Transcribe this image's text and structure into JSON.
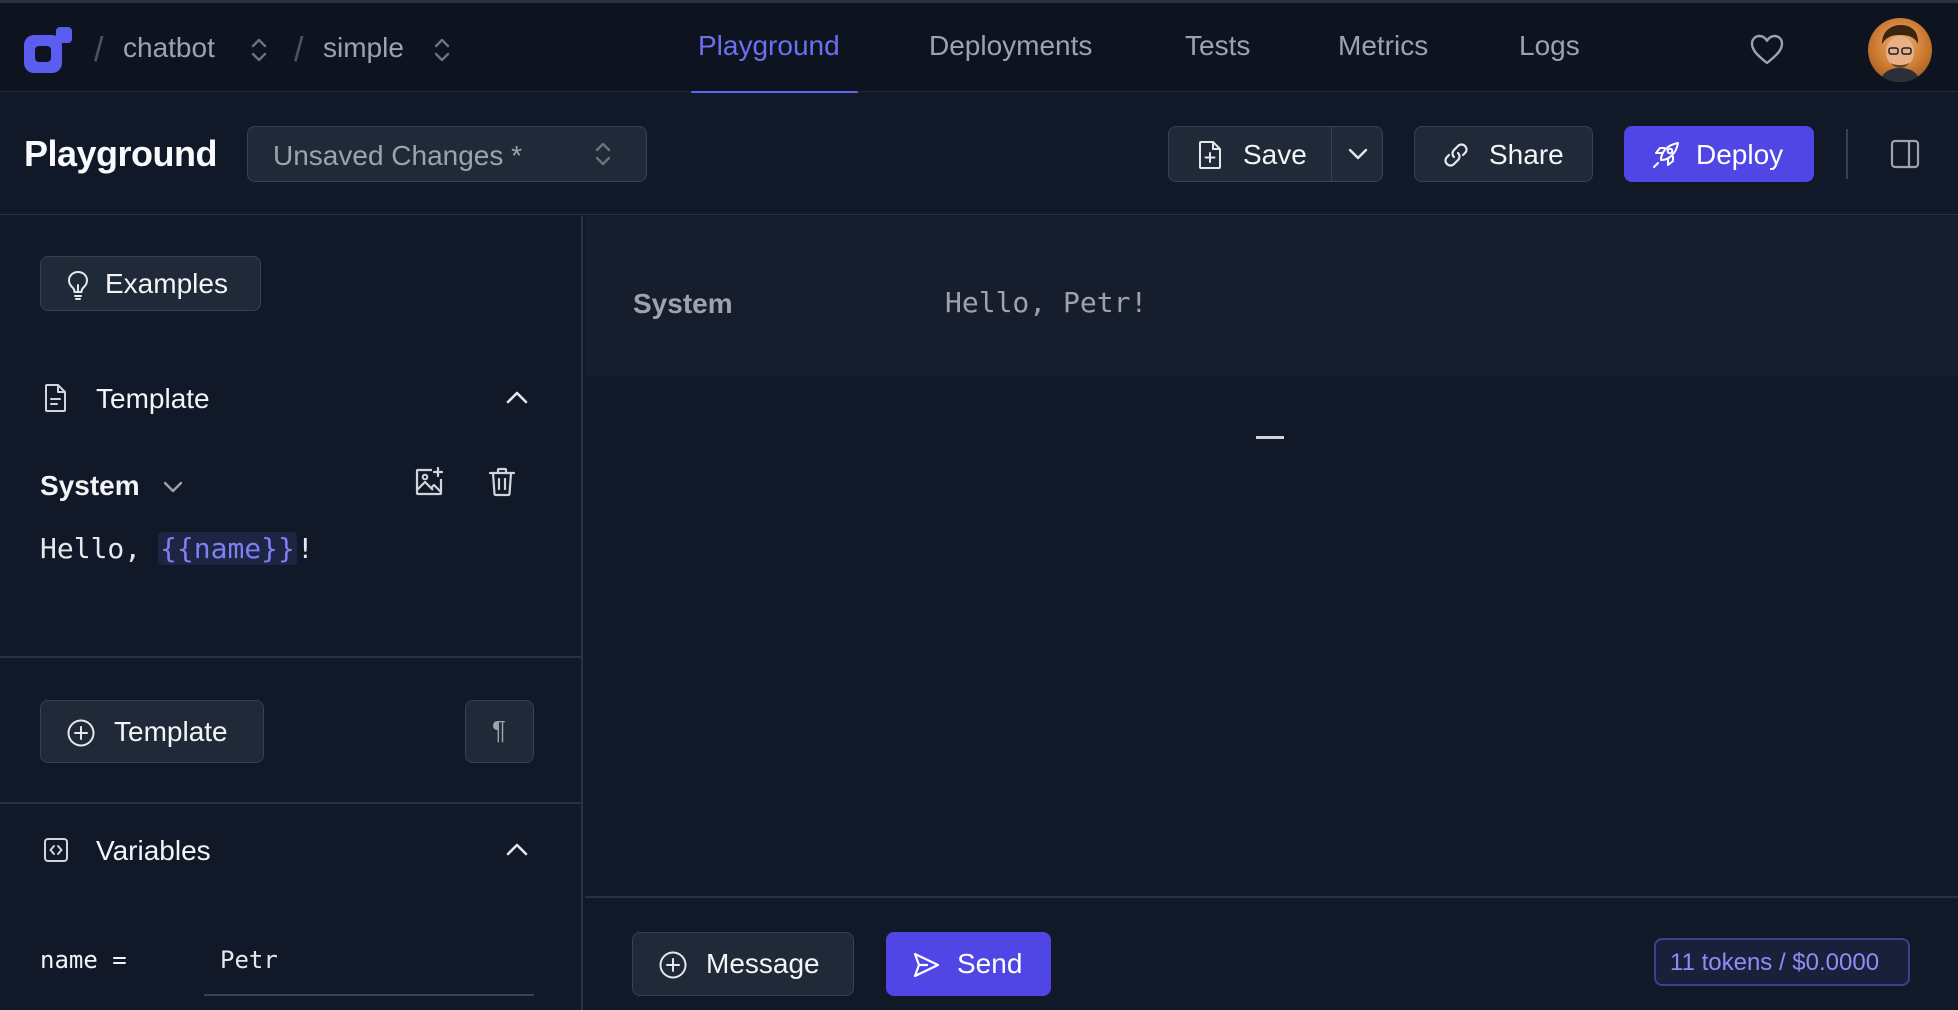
{
  "nav": {
    "project": "chatbot",
    "prompt": "simple",
    "tabs": [
      {
        "label": "Playground",
        "active": true
      },
      {
        "label": "Deployments",
        "active": false
      },
      {
        "label": "Tests",
        "active": false
      },
      {
        "label": "Metrics",
        "active": false
      },
      {
        "label": "Logs",
        "active": false
      }
    ]
  },
  "header": {
    "title": "Playground",
    "version_label": "Unsaved Changes *",
    "save_label": "Save",
    "share_label": "Share",
    "deploy_label": "Deploy"
  },
  "left": {
    "examples_label": "Examples",
    "template_section": "Template",
    "message_role": "System",
    "template_prefix": "Hello, ",
    "template_var": "{{name}}",
    "template_suffix": "!",
    "add_template_label": "Template",
    "pilcrow": "¶",
    "variables_section": "Variables",
    "variable_key": "name =",
    "variable_value": "Petr"
  },
  "right": {
    "role": "System",
    "content": "Hello, Petr!",
    "add_message_label": "Message",
    "send_label": "Send",
    "tokens": "11 tokens / $0.0000"
  },
  "colors": {
    "accent": "#6366f1",
    "primary_button": "#4f46e5",
    "background": "#111827",
    "panel": "#1f2937"
  },
  "icons": [
    "logo-icon",
    "chevron-updown-icon",
    "heart-icon",
    "avatar",
    "file-plus-icon",
    "chevron-down-icon",
    "link-icon",
    "rocket-icon",
    "sidebar-icon",
    "lightbulb-icon",
    "document-icon",
    "chevron-up-icon",
    "image-plus-icon",
    "trash-icon",
    "plus-circle-icon",
    "code-icon",
    "send-icon"
  ]
}
